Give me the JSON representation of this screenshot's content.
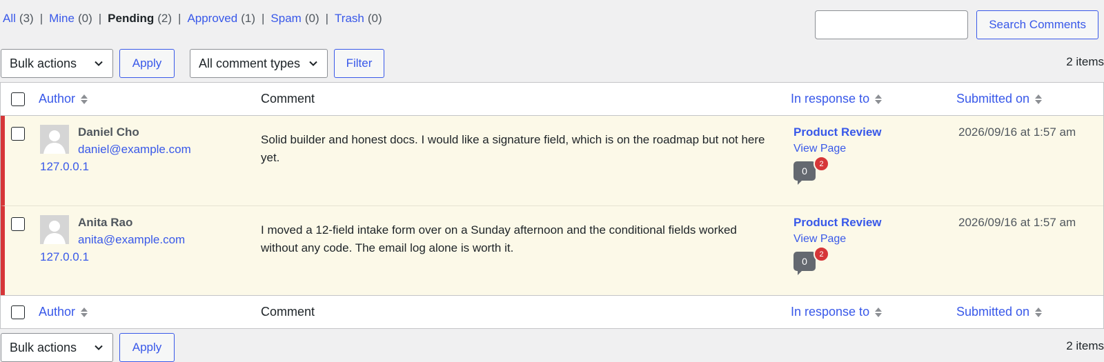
{
  "filters": [
    {
      "label": "All",
      "count": "(3)",
      "current": false
    },
    {
      "label": "Mine",
      "count": "(0)",
      "current": false
    },
    {
      "label": "Pending",
      "count": "(2)",
      "current": true
    },
    {
      "label": "Approved",
      "count": "(1)",
      "current": false
    },
    {
      "label": "Spam",
      "count": "(0)",
      "current": false
    },
    {
      "label": "Trash",
      "count": "(0)",
      "current": false
    }
  ],
  "search": {
    "value": "",
    "button": "Search Comments"
  },
  "toolbar": {
    "bulk_actions": "Bulk actions",
    "apply": "Apply",
    "comment_types": "All comment types",
    "filter": "Filter",
    "items_count": "2 items"
  },
  "columns": {
    "author": "Author",
    "comment": "Comment",
    "response": "In response to",
    "submitted": "Submitted on"
  },
  "rows": [
    {
      "name": "Daniel Cho",
      "email": "daniel@example.com",
      "ip": "127.0.0.1",
      "comment": "Solid builder and honest docs. I would like a signature field, which is on the roadmap but not here yet.",
      "response_title": "Product Review",
      "view_page": "View Page",
      "approved_count": "0",
      "pending_count": "2",
      "submitted": "2026/09/16 at 1:57 am"
    },
    {
      "name": "Anita Rao",
      "email": "anita@example.com",
      "ip": "127.0.0.1",
      "comment": "I moved a 12-field intake form over on a Sunday afternoon and the conditional fields worked without any code. The email log alone is worth it.",
      "response_title": "Product Review",
      "view_page": "View Page",
      "approved_count": "0",
      "pending_count": "2",
      "submitted": "2026/09/16 at 1:57 am"
    }
  ],
  "colors": {
    "link": "#3858e9",
    "pending_border": "#d63638",
    "pending_row_bg": "#fcf9e8"
  }
}
